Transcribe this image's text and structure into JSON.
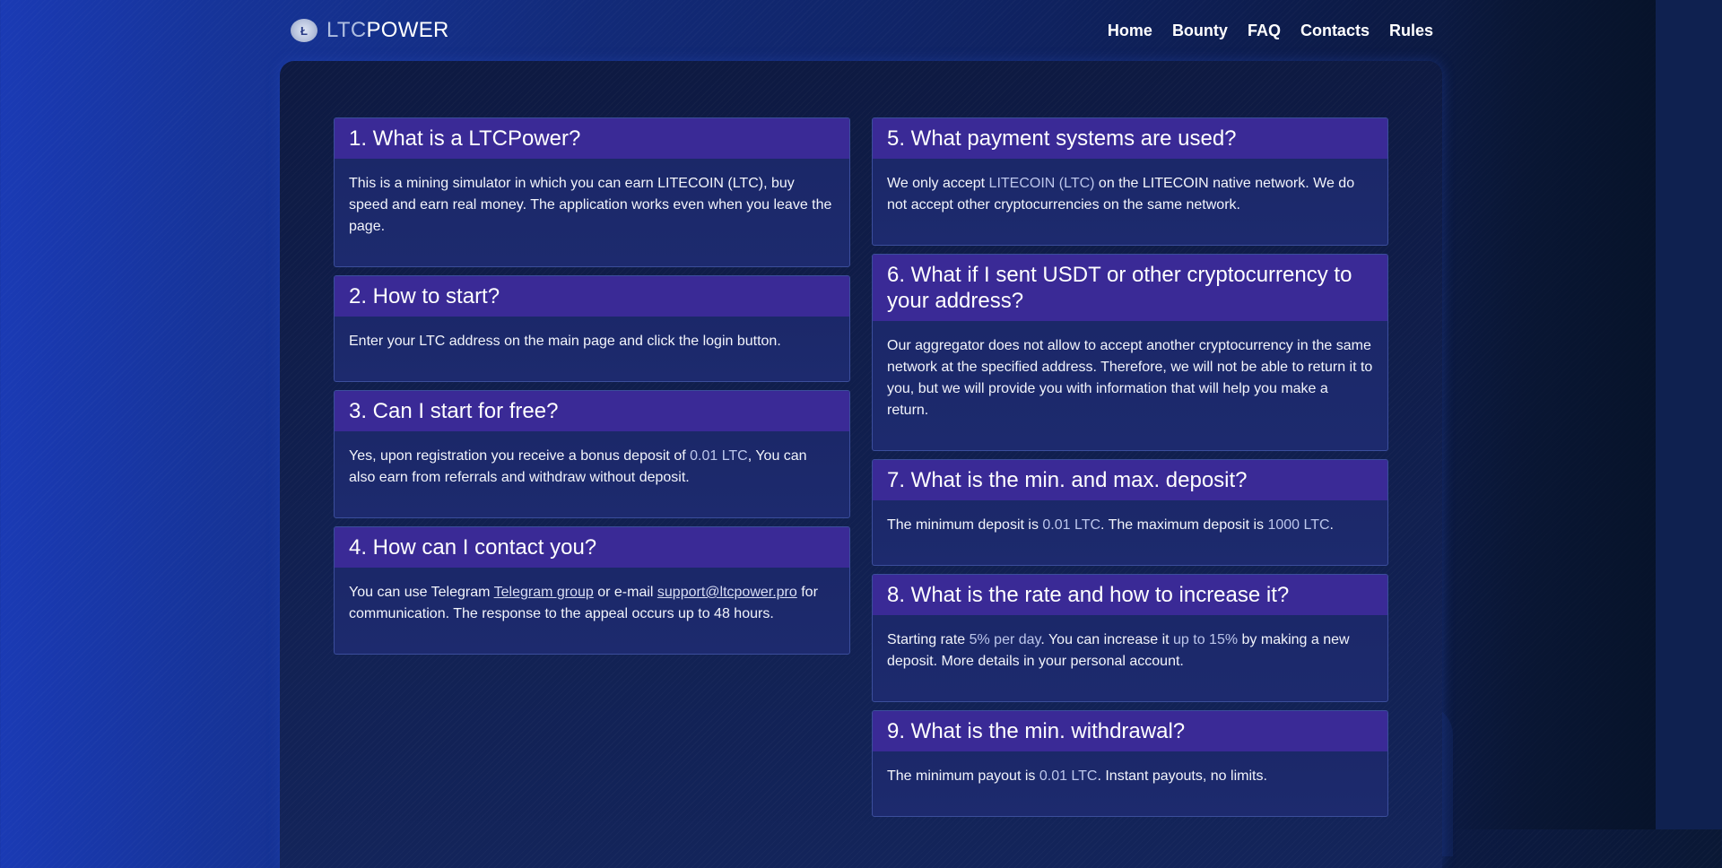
{
  "header": {
    "brand_ltc": "LTC",
    "brand_power": "POWER",
    "nav": [
      "Home",
      "Bounty",
      "FAQ",
      "Contacts",
      "Rules"
    ]
  },
  "faq": {
    "q1": {
      "title": "1. What is a LTCPower?",
      "text": "This is a mining simulator in which you can earn LITECOIN (LTC), buy speed and earn real money. The application works even when you leave the page."
    },
    "q2": {
      "title": "2. How to start?",
      "text": "Enter your LTC address on the main page and click the login button."
    },
    "q3": {
      "title": "3. Can I start for free?",
      "t1": "Yes, upon registration you receive a bonus deposit of ",
      "h1": "0.01 LTC",
      "t2": ", You can also earn from referrals and withdraw without deposit."
    },
    "q4": {
      "title": "4. How can I contact you?",
      "t1": "You can use Telegram ",
      "link1": "Telegram group",
      "t2": " or e-mail ",
      "link2": "support@ltcpower.pro",
      "t3": " for communication. The response to the appeal occurs up to 48 hours."
    },
    "q5": {
      "title": "5. What payment systems are used?",
      "t1": "We only accept ",
      "h1": "LITECOIN (LTC)",
      "t2": " on the LITECOIN native network. We do not accept other cryptocurrencies on the same network."
    },
    "q6": {
      "title": "6. What if I sent USDT or other cryptocurrency to your address?",
      "text": "Our aggregator does not allow to accept another cryptocurrency in the same network at the specified address. Therefore, we will not be able to return it to you, but we will provide you with information that will help you make a return."
    },
    "q7": {
      "title": "7. What is the min. and max. deposit?",
      "t1": "The minimum deposit is ",
      "h1": "0.01 LTC",
      "t2": ". The maximum deposit is ",
      "h2": "1000 LTC",
      "t3": "."
    },
    "q8": {
      "title": "8. What is the rate and how to increase it?",
      "t1": "Starting rate ",
      "h1": "5% per day",
      "t2": ". You can increase it ",
      "h2": "up to 15%",
      "t3": " by making a new deposit. More details in your personal account."
    },
    "q9": {
      "title": "9. What is the min. withdrawal?",
      "t1": "The minimum payout is ",
      "h1": "0.01 LTC",
      "t2": ". Instant payouts, no limits."
    }
  }
}
